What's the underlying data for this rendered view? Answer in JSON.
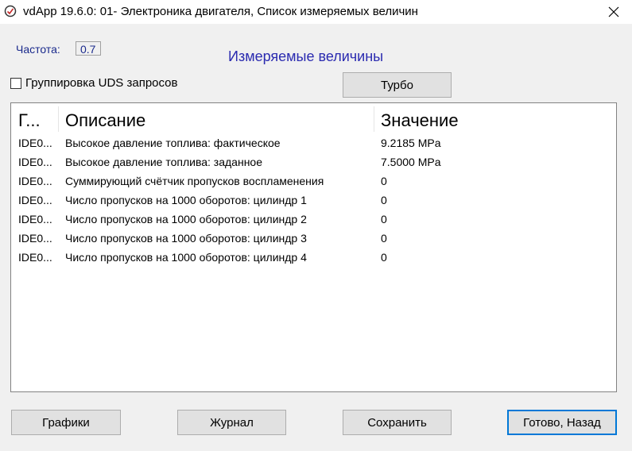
{
  "window": {
    "title": "vdApp 19.6.0: 01- Электроника двигателя,  Список измеряемых величин",
    "icon": "diagnostic-app-icon"
  },
  "frequency": {
    "label": "Частота:",
    "value": "0.7"
  },
  "section_title": "Измеряемые величины",
  "uds_grouping": {
    "label": "Группировка UDS запросов",
    "checked": false
  },
  "turbo_button": "Турбо",
  "table": {
    "headers": {
      "group": "Г...",
      "description": "Описание",
      "value": "Значение"
    },
    "rows": [
      {
        "id": "IDE0...",
        "description": "Высокое давление топлива: фактическое",
        "value": "9.2185 MPa"
      },
      {
        "id": "IDE0...",
        "description": "Высокое давление топлива: заданное",
        "value": "7.5000 MPa"
      },
      {
        "id": "IDE0...",
        "description": "Суммирующий счётчик пропусков воспламенения",
        "value": "0"
      },
      {
        "id": "IDE0...",
        "description": "Число пропусков на 1000 оборотов: цилиндр 1",
        "value": "0"
      },
      {
        "id": "IDE0...",
        "description": "Число пропусков на 1000 оборотов: цилиндр 2",
        "value": "0"
      },
      {
        "id": "IDE0...",
        "description": "Число пропусков на 1000 оборотов: цилиндр 3",
        "value": "0"
      },
      {
        "id": "IDE0...",
        "description": "Число пропусков на 1000 оборотов: цилиндр 4",
        "value": "0"
      }
    ]
  },
  "buttons": {
    "charts": "Графики",
    "log": "Журнал",
    "save": "Сохранить",
    "done_back": "Готово, Назад"
  },
  "colors": {
    "accent": "#0078d7",
    "label_blue": "#1a2a8c",
    "title_blue": "#2b2bb0"
  }
}
